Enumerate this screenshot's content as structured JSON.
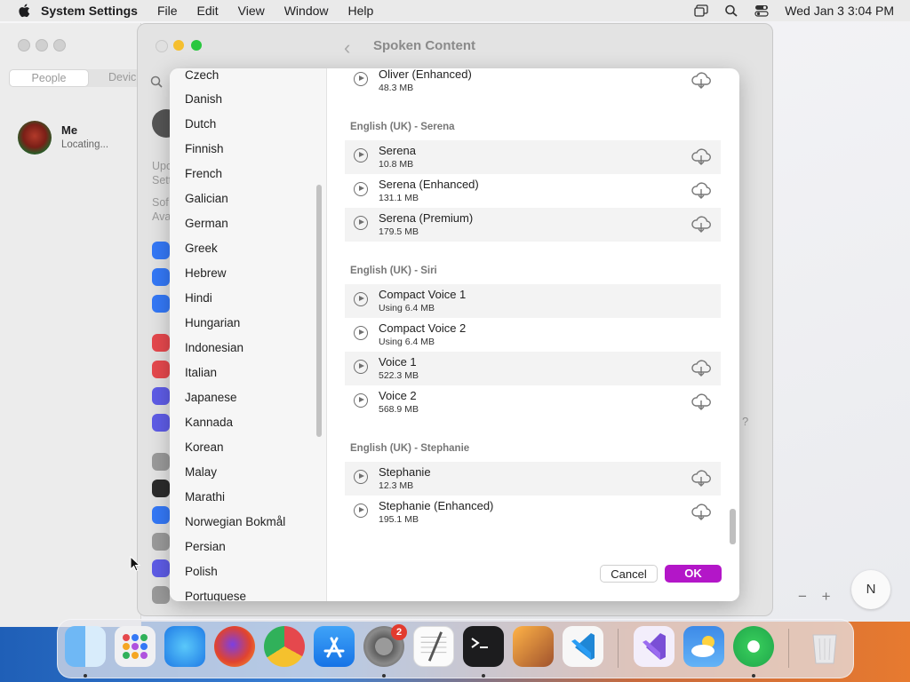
{
  "menubar": {
    "app_name": "System Settings",
    "items": [
      "File",
      "Edit",
      "View",
      "Window",
      "Help"
    ],
    "clock": "Wed Jan 3  3:04 PM"
  },
  "contacts": {
    "segments": [
      "People",
      "Devic"
    ],
    "me_name": "Me",
    "me_status": "Locating..."
  },
  "settings": {
    "title": "Spoken Content",
    "sidebar_fragments": [
      "Upc",
      "Sett",
      "Sof",
      "Ava"
    ]
  },
  "languages": [
    "Czech",
    "Danish",
    "Dutch",
    "Finnish",
    "French",
    "Galician",
    "German",
    "Greek",
    "Hebrew",
    "Hindi",
    "Hungarian",
    "Indonesian",
    "Italian",
    "Japanese",
    "Kannada",
    "Korean",
    "Malay",
    "Marathi",
    "Norwegian Bokmål",
    "Persian",
    "Polish",
    "Portuguese"
  ],
  "voices": {
    "top_row": {
      "name": "Oliver (Enhanced)",
      "size": "48.3 MB"
    },
    "groups": [
      {
        "title": "English (UK) - Serena",
        "items": [
          {
            "name": "Serena",
            "size": "10.8 MB",
            "download": true
          },
          {
            "name": "Serena (Enhanced)",
            "size": "131.1 MB",
            "download": true
          },
          {
            "name": "Serena (Premium)",
            "size": "179.5 MB",
            "download": true
          }
        ]
      },
      {
        "title": "English (UK) - Siri",
        "items": [
          {
            "name": "Compact Voice 1",
            "size": "Using 6.4 MB",
            "download": false
          },
          {
            "name": "Compact Voice 2",
            "size": "Using 6.4 MB",
            "download": false
          },
          {
            "name": "Voice 1",
            "size": "522.3 MB",
            "download": true
          },
          {
            "name": "Voice 2",
            "size": "568.9 MB",
            "download": true
          }
        ]
      },
      {
        "title": "English (UK) - Stephanie",
        "items": [
          {
            "name": "Stephanie",
            "size": "12.3 MB",
            "download": true
          },
          {
            "name": "Stephanie (Enhanced)",
            "size": "195.1 MB",
            "download": true
          }
        ]
      }
    ]
  },
  "buttons": {
    "cancel": "Cancel",
    "ok": "OK"
  },
  "map_controls": {
    "zoom_out": "−",
    "zoom_in": "+",
    "compass": "N"
  },
  "help_mark": "?",
  "dock": {
    "apps": [
      "Finder",
      "Launchpad",
      "Safari",
      "Firefox",
      "Chrome",
      "App Store",
      "System Settings",
      "TextEdit",
      "Terminal",
      "GarageBand",
      "Visual Studio Code",
      "Visual Studio",
      "Weather",
      "Find My",
      "Trash"
    ],
    "settings_badge": "2"
  },
  "colors": {
    "accent": "#b316c8"
  }
}
